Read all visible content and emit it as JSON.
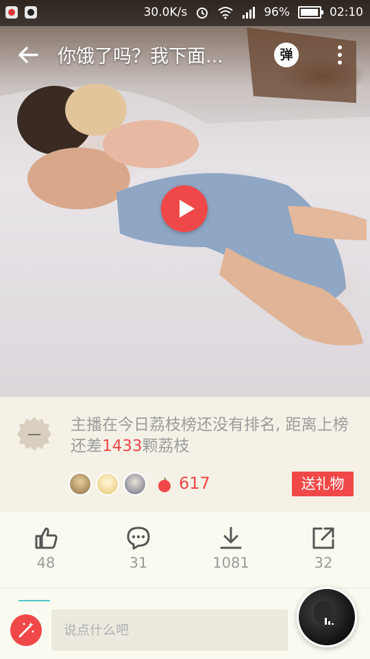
{
  "status_bar": {
    "speed": "30.0K/s",
    "battery": "96%",
    "time": "02:10",
    "icons": [
      "app-icon",
      "qq-icon",
      "alarm-icon",
      "wifi-icon",
      "signal-icon",
      "battery-icon"
    ]
  },
  "header": {
    "title": "你饿了吗？我下面...",
    "danmaku_label": "弹"
  },
  "rank": {
    "text_before": "主播在今日荔枝榜还没有排名, 距离上榜还差",
    "highlight": "1433",
    "text_after": "颗荔枝",
    "badge_label": "—",
    "litchi_count": "617",
    "gift_label": "送礼物",
    "fan_count_shown": 3
  },
  "actions": [
    {
      "name": "like",
      "icon": "thumbs-up-icon",
      "count": "48"
    },
    {
      "name": "comment",
      "icon": "comment-icon",
      "count": "31"
    },
    {
      "name": "download",
      "icon": "download-icon",
      "count": "1081"
    },
    {
      "name": "share",
      "icon": "share-icon",
      "count": "32"
    }
  ],
  "comment": {
    "placeholder": "说点什么吧"
  },
  "colors": {
    "accent": "#f04848",
    "muted_text": "#9c9c9c",
    "panel_bg": "#f5f1e6",
    "tab_indicator": "#4cc8c8"
  }
}
